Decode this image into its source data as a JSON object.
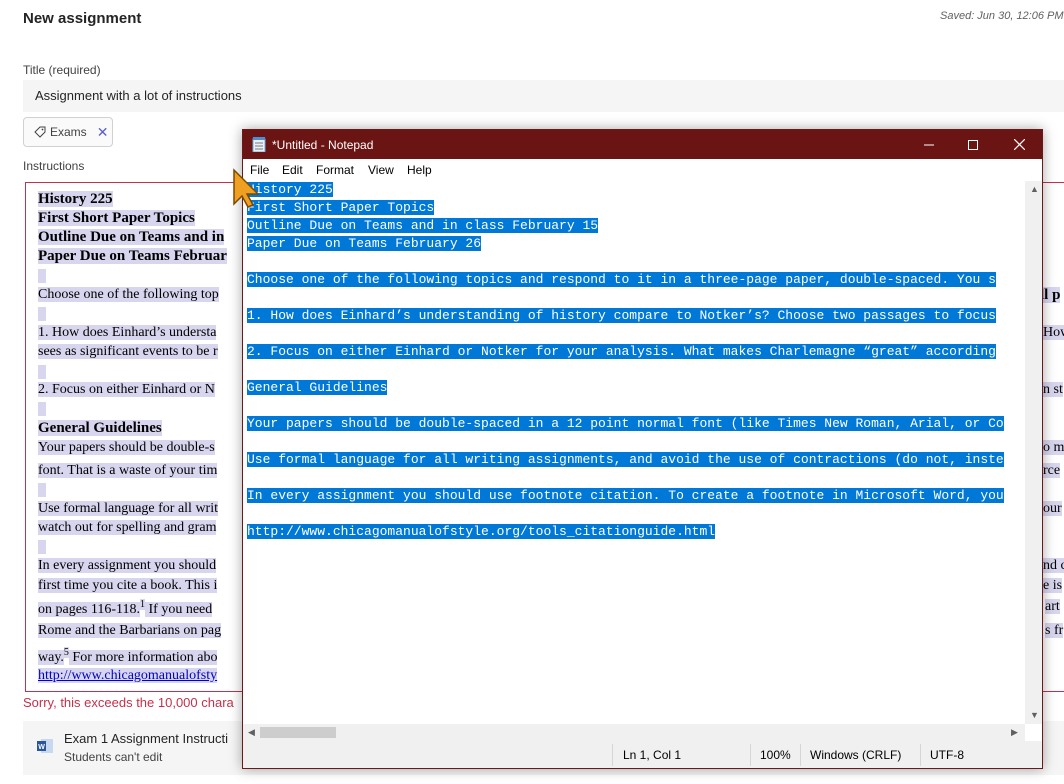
{
  "header": {
    "title": "New assignment",
    "saved": "Saved: Jun 30, 12:06 PM"
  },
  "form": {
    "title_label": "Title (required)",
    "title_value": "Assignment with a lot of instructions",
    "tag_label": "Exams",
    "instructions_label": "Instructions",
    "error": "Sorry, this exceeds the 10,000 chara"
  },
  "editor": {
    "lines": [
      "History 225",
      "First Short Paper Topics",
      "Outline Due on Teams and in",
      "Paper Due on Teams Februar",
      "Choose one of the following top",
      "1. How does Einhard’s understa",
      "sees as significant events to be r",
      "2. Focus on either Einhard or N",
      "General Guidelines",
      "Your papers should be double-s",
      "font.  That is a waste of your tim",
      "Use formal language for all writ",
      "watch out for spelling and gram",
      "In every assignment you should",
      "first time you cite a book. This i",
      "on pages 116-118.",
      "1",
      " If you need",
      "Rome and the Barbarians on pag",
      "way.",
      "5",
      " For more information abo",
      "http://www.chicagomanualofsty"
    ],
    "right_edge": [
      "ll p",
      "How",
      "n st",
      "o m",
      "orce",
      "your",
      "nd c",
      "e is",
      "art",
      "s fr"
    ]
  },
  "attachment": {
    "name": "Exam 1 Assignment Instructi",
    "sub": "Students can't edit"
  },
  "notepad": {
    "title": "*Untitled - Notepad",
    "menus": [
      "File",
      "Edit",
      "Format",
      "View",
      "Help"
    ],
    "lines": [
      "History 225 ",
      "First Short Paper Topics ",
      "Outline Due on Teams and in class February 15 ",
      "Paper Due on Teams February 26 ",
      "Choose one of the following topics and respond to it in a three-page paper, double-spaced.  You s",
      "1. How does Einhard’s understanding of history compare to Notker’s? Choose two passages to focus ",
      "2. Focus on either Einhard or Notker for your analysis. What makes Charlemagne “great” according ",
      "General Guidelines ",
      "Your papers should be double-spaced in a 12 point normal font (like Times New Roman, Arial, or Co",
      "Use formal language for all writing assignments, and avoid the use of contractions (do not, inste",
      "In every assignment you should use footnote citation. To create a footnote in Microsoft Word, you",
      "http://www.chicagomanualofstyle.org/tools_citationguide.html  "
    ],
    "status": {
      "position": "Ln 1, Col 1",
      "zoom": "100%",
      "line_endings": "Windows (CRLF)",
      "encoding": "UTF-8"
    }
  },
  "colors": {
    "notepad_titlebar": "#6b1414",
    "selection": "#0078d7",
    "editor_highlight": "#d8d6ee",
    "error": "#c4314b"
  }
}
